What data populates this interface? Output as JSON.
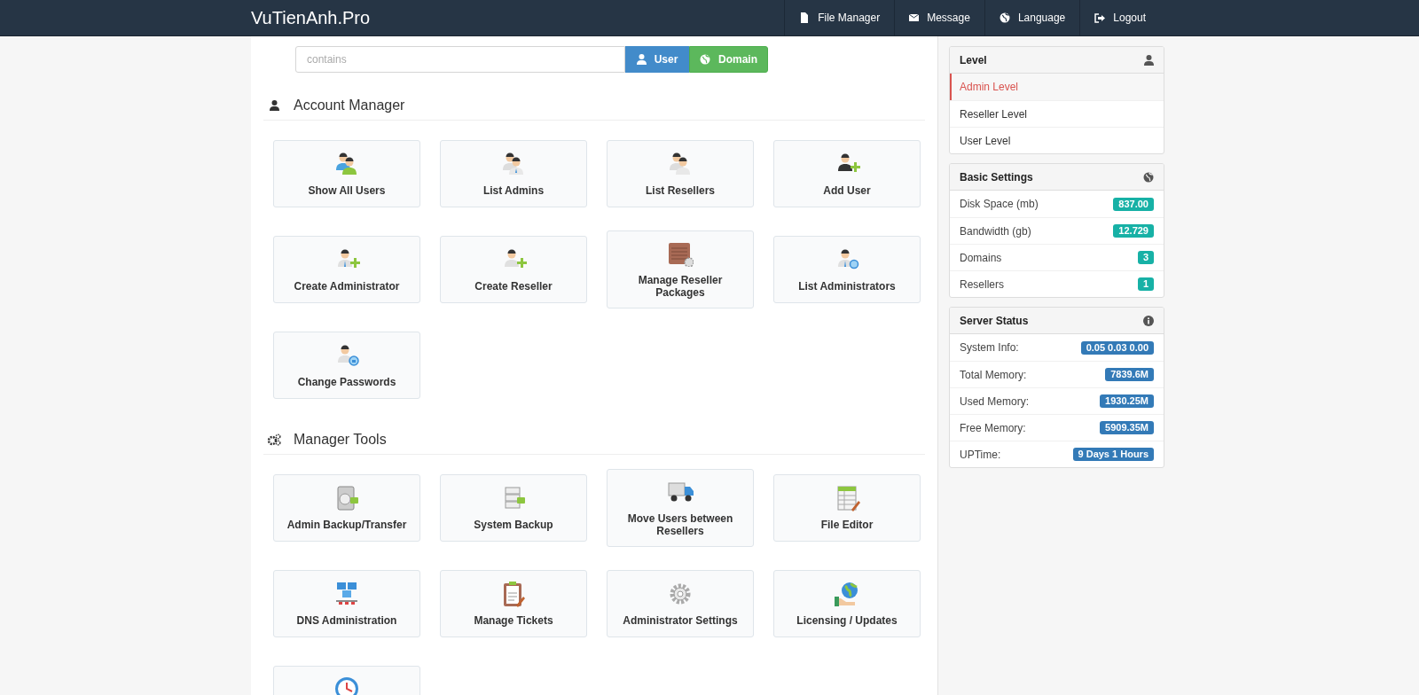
{
  "header": {
    "brand": "VuTienAnh.Pro",
    "nav": [
      {
        "label": "File Manager"
      },
      {
        "label": "Message"
      },
      {
        "label": "Language"
      },
      {
        "label": "Logout"
      }
    ]
  },
  "search": {
    "placeholder": "contains",
    "buttons": [
      {
        "label": "User",
        "kind": "user"
      },
      {
        "label": "Domain",
        "kind": "domain"
      }
    ]
  },
  "sections": [
    {
      "title": "Account Manager",
      "tiles": [
        {
          "label": "Show All Users"
        },
        {
          "label": "List Admins"
        },
        {
          "label": "List Resellers"
        },
        {
          "label": "Add User"
        },
        {
          "label": "Create Administrator"
        },
        {
          "label": "Create Reseller"
        },
        {
          "label": "Manage Reseller Packages"
        },
        {
          "label": "List Administrators"
        },
        {
          "label": "Change Passwords"
        }
      ]
    },
    {
      "title": "Manager Tools",
      "tiles": [
        {
          "label": "Admin Backup/Transfer"
        },
        {
          "label": "System Backup"
        },
        {
          "label": "Move Users between Resellers"
        },
        {
          "label": "File Editor"
        },
        {
          "label": "DNS Administration"
        },
        {
          "label": "Manage Tickets"
        },
        {
          "label": "Administrator Settings"
        },
        {
          "label": "Licensing / Updates"
        },
        {
          "cut_off": true
        }
      ]
    }
  ],
  "sidebar": {
    "level": {
      "title": "Level",
      "items": [
        {
          "label": "Admin Level",
          "selected": true
        },
        {
          "label": "Reseller Level",
          "selected": false
        },
        {
          "label": "User Level",
          "selected": false
        }
      ]
    },
    "basic_settings": {
      "title": "Basic Settings",
      "rows": [
        {
          "label": "Disk Space (mb)",
          "value": "837.00"
        },
        {
          "label": "Bandwidth (gb)",
          "value": "12.729"
        },
        {
          "label": "Domains",
          "value": "3"
        },
        {
          "label": "Resellers",
          "value": "1"
        }
      ]
    },
    "server_status": {
      "title": "Server Status",
      "rows": [
        {
          "label": "System Info:",
          "value": "0.05 0.03 0.00"
        },
        {
          "label": "Total Memory:",
          "value": "7839.6M"
        },
        {
          "label": "Used Memory:",
          "value": "1930.25M"
        },
        {
          "label": "Free Memory:",
          "value": "5909.35M"
        },
        {
          "label": "UPTime:",
          "value": "9 Days 1 Hours"
        }
      ]
    }
  }
}
